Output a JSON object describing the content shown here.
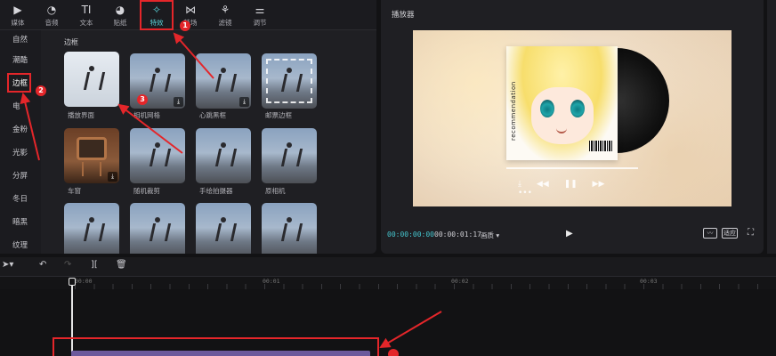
{
  "toolbar": {
    "tools": [
      {
        "label": "媒体",
        "icon": "media-icon"
      },
      {
        "label": "音频",
        "icon": "audio-icon"
      },
      {
        "label": "文本",
        "icon": "text-icon"
      },
      {
        "label": "贴纸",
        "icon": "sticker-icon"
      },
      {
        "label": "特效",
        "icon": "effects-icon"
      },
      {
        "label": "转场",
        "icon": "transition-icon"
      },
      {
        "label": "滤镜",
        "icon": "filter-icon"
      },
      {
        "label": "调节",
        "icon": "adjust-icon"
      }
    ],
    "active": "特效",
    "text_icon_glyph": "TI"
  },
  "sidebar": {
    "items": [
      "自然",
      "潮酷",
      "边框",
      "电",
      "金粉",
      "光影",
      "分屏",
      "冬日",
      "暗黑",
      "纹理"
    ],
    "active": "边框"
  },
  "effects": {
    "section_title": "边框",
    "tiles": [
      {
        "label": "播放界面"
      },
      {
        "label": "相机网格"
      },
      {
        "label": "心跳黑框"
      },
      {
        "label": "邮票边框"
      },
      {
        "label": "车窗"
      },
      {
        "label": "随机裁剪"
      },
      {
        "label": "手绘拍摄器"
      },
      {
        "label": "原相机"
      },
      {
        "label": ""
      },
      {
        "label": ""
      },
      {
        "label": ""
      },
      {
        "label": ""
      }
    ]
  },
  "player": {
    "title": "播放器",
    "cover_text": "recommendation",
    "time_current": "00:00:00:00",
    "time_total": "00:00:01:17",
    "quality": "画质 ▾",
    "ratio": "适应"
  },
  "timeline": {
    "marks": [
      "00:00",
      "00:01",
      "00:02",
      "00:03"
    ]
  },
  "annotations": {
    "step1": "1",
    "step2": "2",
    "step3": "3"
  },
  "colors": {
    "accent": "#5ad3d9",
    "annotation_red": "#e4262a",
    "clip": "#6c5a9c"
  }
}
